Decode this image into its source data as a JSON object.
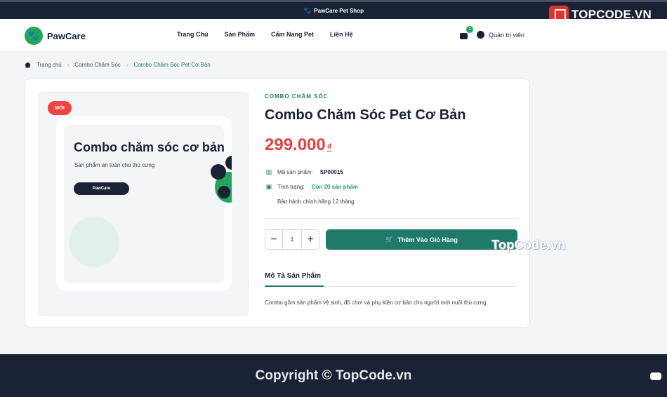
{
  "topbar": {
    "shop_name": "PawCare Pet Shop"
  },
  "watermark": {
    "logo_text": "TOPCODE.VN",
    "mid_text": "TopCode.vn"
  },
  "header": {
    "brand": "PawCare",
    "nav": [
      "Trang Chủ",
      "Sản Phẩm",
      "Cẩm Nang Pet",
      "Liên Hệ"
    ],
    "cart_count": "1",
    "admin_label": "Quản trị viên"
  },
  "breadcrumb": {
    "home": "Trang chủ",
    "category": "Combo Chăm Sóc",
    "current": "Combo Chăm Sóc Pet Cơ Bản"
  },
  "product": {
    "badge": "MỚI",
    "image_title": "Combo chăm sóc cơ bản",
    "image_subtitle": "Sản phẩm an toàn cho thú cưng",
    "image_button": "PawCare",
    "category": "COMBO CHĂM SÓC",
    "title": "Combo Chăm Sóc Pet Cơ Bản",
    "price": "299.000",
    "currency": "₫",
    "sku_label": "Mã sản phẩm:",
    "sku": "SP00015",
    "stock_label": "Tình trạng:",
    "stock": "Còn 20 sản phẩm",
    "warranty": "Bảo hành chính hãng 12 tháng",
    "quantity": "1",
    "add_to_cart": "Thêm Vào Giỏ Hàng",
    "tab_description": "Mô Tả Sản Phẩm",
    "description": "Combo gồm sản phẩm vệ sinh, đồ chơi và phụ kiện cơ bản cho người mới nuôi thú cưng."
  },
  "footer": {
    "copyright": "Copyright © TopCode.vn"
  },
  "colors": {
    "primary": "#1f7a6b",
    "accent_green": "#22a55c",
    "price_red": "#e24245",
    "dark_navy": "#1a2235"
  }
}
